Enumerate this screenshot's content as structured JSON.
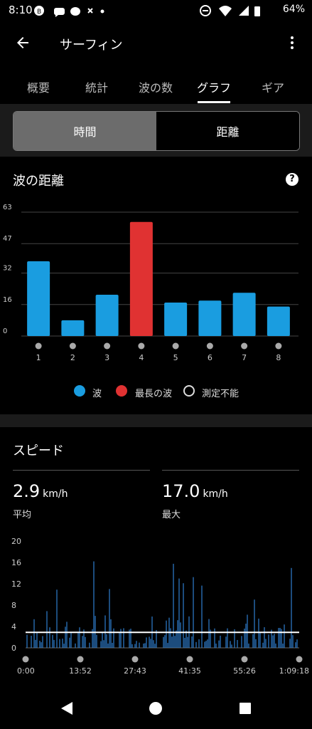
{
  "status_bar": {
    "time": "8:10",
    "battery": "64%"
  },
  "app_bar": {
    "title": "サーフィン",
    "back_icon": "arrow-back-icon",
    "more_icon": "more-vert-icon"
  },
  "tabs": [
    {
      "label": "概要",
      "active": false
    },
    {
      "label": "統計",
      "active": false
    },
    {
      "label": "波の数",
      "active": false
    },
    {
      "label": "グラフ",
      "active": true
    },
    {
      "label": "ギア",
      "active": false
    }
  ],
  "segmented": {
    "time_label": "時間",
    "distance_label": "距離",
    "selected": "時間"
  },
  "distance_card": {
    "title": "波の距離",
    "legend": {
      "wave": "波",
      "longest": "最長の波",
      "unmeasurable": "測定不能"
    }
  },
  "speed_card": {
    "title": "スピード",
    "avg": {
      "value": "2.9",
      "unit": "km/h",
      "label": "平均"
    },
    "max": {
      "value": "17.0",
      "unit": "km/h",
      "label": "最大"
    }
  },
  "colors": {
    "wave": "#1a9de0",
    "longest": "#e03232",
    "grid": "#444444",
    "avg_line": "#ffffff",
    "speed_bars": "#2f7fd0"
  },
  "chart_data": [
    {
      "type": "bar",
      "title": "波の距離",
      "categories": [
        "1",
        "2",
        "3",
        "4",
        "5",
        "6",
        "7",
        "8"
      ],
      "values": [
        38,
        8,
        21,
        58,
        17,
        18,
        22,
        15
      ],
      "highlight_index": 3,
      "y_ticks": [
        "0",
        "16",
        "32",
        "47",
        "63"
      ],
      "ylim": [
        0,
        63
      ],
      "grid": true
    },
    {
      "type": "bar",
      "title": "スピード",
      "y_ticks": [
        "0",
        "4",
        "8",
        "12",
        "16",
        "20"
      ],
      "ylim": [
        0,
        20
      ],
      "x_ticks": [
        "0:00",
        "13:52",
        "27:43",
        "41:35",
        "55:26",
        "1:09:18"
      ],
      "average": 2.9,
      "max": 17.0
    }
  ],
  "nav": {
    "back_icon": "nav-back-icon",
    "home_icon": "nav-home-icon",
    "recents_icon": "nav-recents-icon"
  }
}
